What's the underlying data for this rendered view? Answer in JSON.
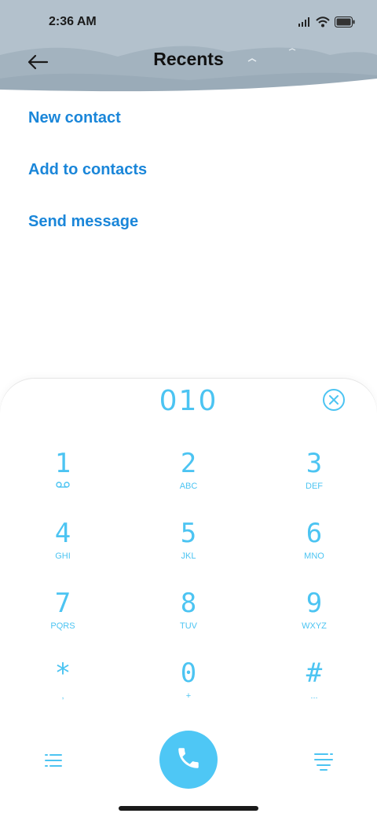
{
  "status_bar": {
    "time": "2:36 AM",
    "icons": [
      "signal-icon",
      "wifi-icon",
      "battery-icon"
    ]
  },
  "header": {
    "title": "Recents",
    "back_icon": "arrow-left-icon"
  },
  "actions": [
    {
      "label": "New contact"
    },
    {
      "label": "Add to contacts"
    },
    {
      "label": "Send message"
    }
  ],
  "dialpad": {
    "number": "010",
    "clear_icon": "clear-circle-x-icon",
    "keys": [
      {
        "digit": "1",
        "sub": "voicemail-icon"
      },
      {
        "digit": "2",
        "sub": "ABC"
      },
      {
        "digit": "3",
        "sub": "DEF"
      },
      {
        "digit": "4",
        "sub": "GHI"
      },
      {
        "digit": "5",
        "sub": "JKL"
      },
      {
        "digit": "6",
        "sub": "MNO"
      },
      {
        "digit": "7",
        "sub": "PQRS"
      },
      {
        "digit": "8",
        "sub": "TUV"
      },
      {
        "digit": "9",
        "sub": "WXYZ"
      },
      {
        "digit": "*",
        "sub": ","
      },
      {
        "digit": "0",
        "sub": "+"
      },
      {
        "digit": "#",
        "sub": "..."
      }
    ]
  },
  "bottom": {
    "left_icon": "list-menu-icon",
    "call_icon": "phone-icon",
    "right_icon": "filter-menu-icon"
  },
  "colors": {
    "accent": "#4cc4f2",
    "link": "#1a86d9",
    "header_bg": "#a7b7c3",
    "call_button": "#4ec7f5"
  }
}
